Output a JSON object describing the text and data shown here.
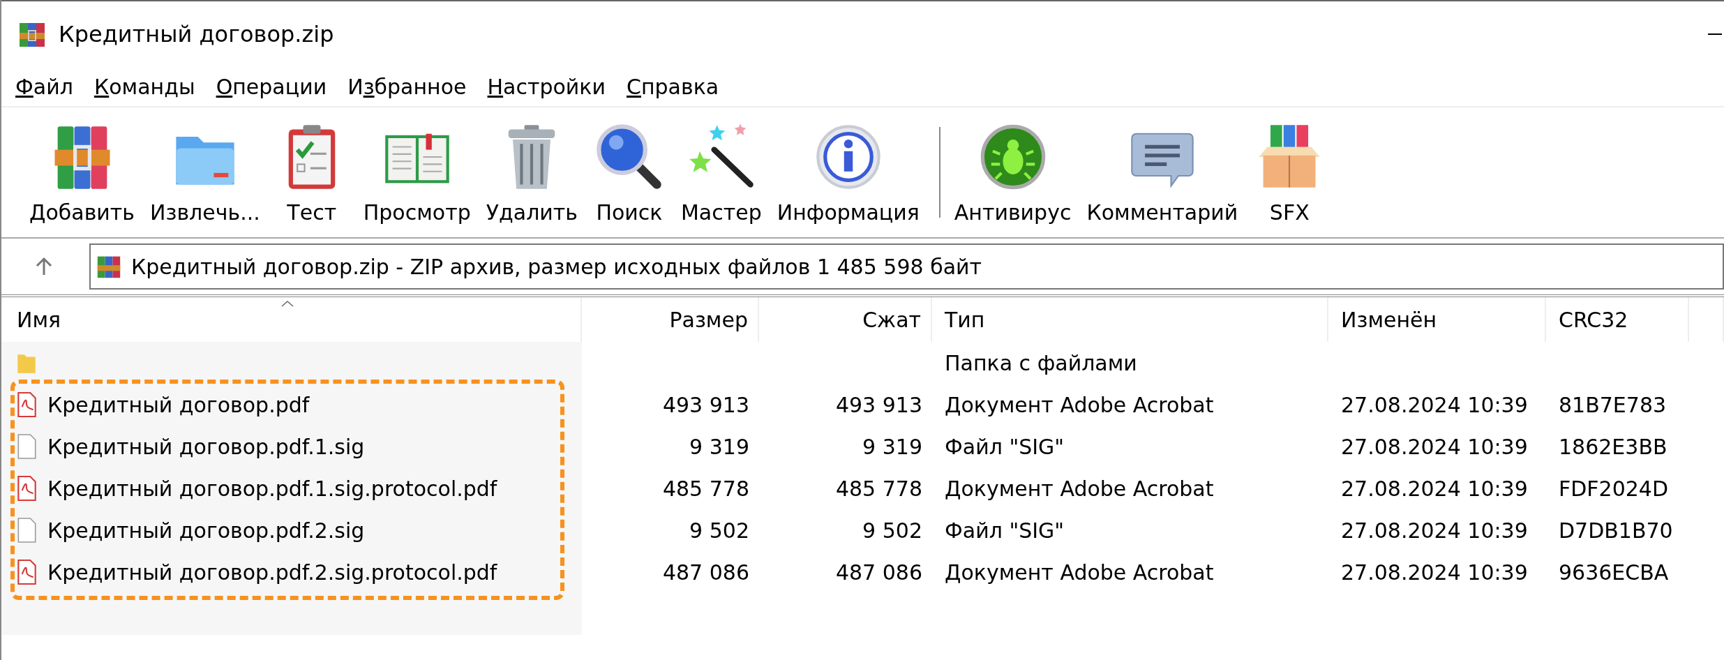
{
  "window": {
    "title": "Кредитный договор.zip"
  },
  "menu": [
    {
      "key": "Ф",
      "post": "айл"
    },
    {
      "key": "К",
      "post": "оманды"
    },
    {
      "key": "О",
      "post": "перации"
    },
    {
      "pre": "И",
      "key": "з",
      "post": "бранное"
    },
    {
      "key": "Н",
      "post": "астройки"
    },
    {
      "key": "С",
      "post": "правка"
    }
  ],
  "toolbar": {
    "groups": [
      [
        {
          "kind": "add",
          "label": "Добавить"
        },
        {
          "kind": "extract",
          "label": "Извлечь..."
        },
        {
          "kind": "test",
          "label": "Тест"
        },
        {
          "kind": "view",
          "label": "Просмотр"
        },
        {
          "kind": "delete",
          "label": "Удалить"
        },
        {
          "kind": "find",
          "label": "Поиск"
        },
        {
          "kind": "wizard",
          "label": "Мастер"
        },
        {
          "kind": "info",
          "label": "Информация"
        }
      ],
      [
        {
          "kind": "antivirus",
          "label": "Антивирус"
        },
        {
          "kind": "comment",
          "label": "Комментарий"
        },
        {
          "kind": "sfx",
          "label": "SFX"
        }
      ]
    ]
  },
  "address": {
    "value": "Кредитный договор.zip - ZIP архив, размер исходных файлов 1 485 598 байт"
  },
  "table": {
    "columns": [
      "Имя",
      "Размер",
      "Сжат",
      "Тип",
      "Изменён",
      "CRC32"
    ],
    "rows": [
      {
        "kind": "folder",
        "type": "Папка с файлами"
      },
      {
        "kind": "pdf",
        "name": "Кредитный договор.pdf",
        "size": "493 913",
        "packed": "493 913",
        "type": "Документ Adobe Acrobat",
        "modified": "27.08.2024 10:39",
        "crc": "81B7E783"
      },
      {
        "kind": "file",
        "name": "Кредитный договор.pdf.1.sig",
        "size": "9 319",
        "packed": "9 319",
        "type": "Файл \"SIG\"",
        "modified": "27.08.2024 10:39",
        "crc": "1862E3BB"
      },
      {
        "kind": "pdf",
        "name": "Кредитный договор.pdf.1.sig.protocol.pdf",
        "size": "485 778",
        "packed": "485 778",
        "type": "Документ Adobe Acrobat",
        "modified": "27.08.2024 10:39",
        "crc": "FDF2024D"
      },
      {
        "kind": "file",
        "name": "Кредитный договор.pdf.2.sig",
        "size": "9 502",
        "packed": "9 502",
        "type": "Файл \"SIG\"",
        "modified": "27.08.2024 10:39",
        "crc": "D7DB1B70"
      },
      {
        "kind": "pdf",
        "name": "Кредитный договор.pdf.2.sig.protocol.pdf",
        "size": "487 086",
        "packed": "487 086",
        "type": "Документ Adobe Acrobat",
        "modified": "27.08.2024 10:39",
        "crc": "9636ECBA"
      }
    ]
  }
}
